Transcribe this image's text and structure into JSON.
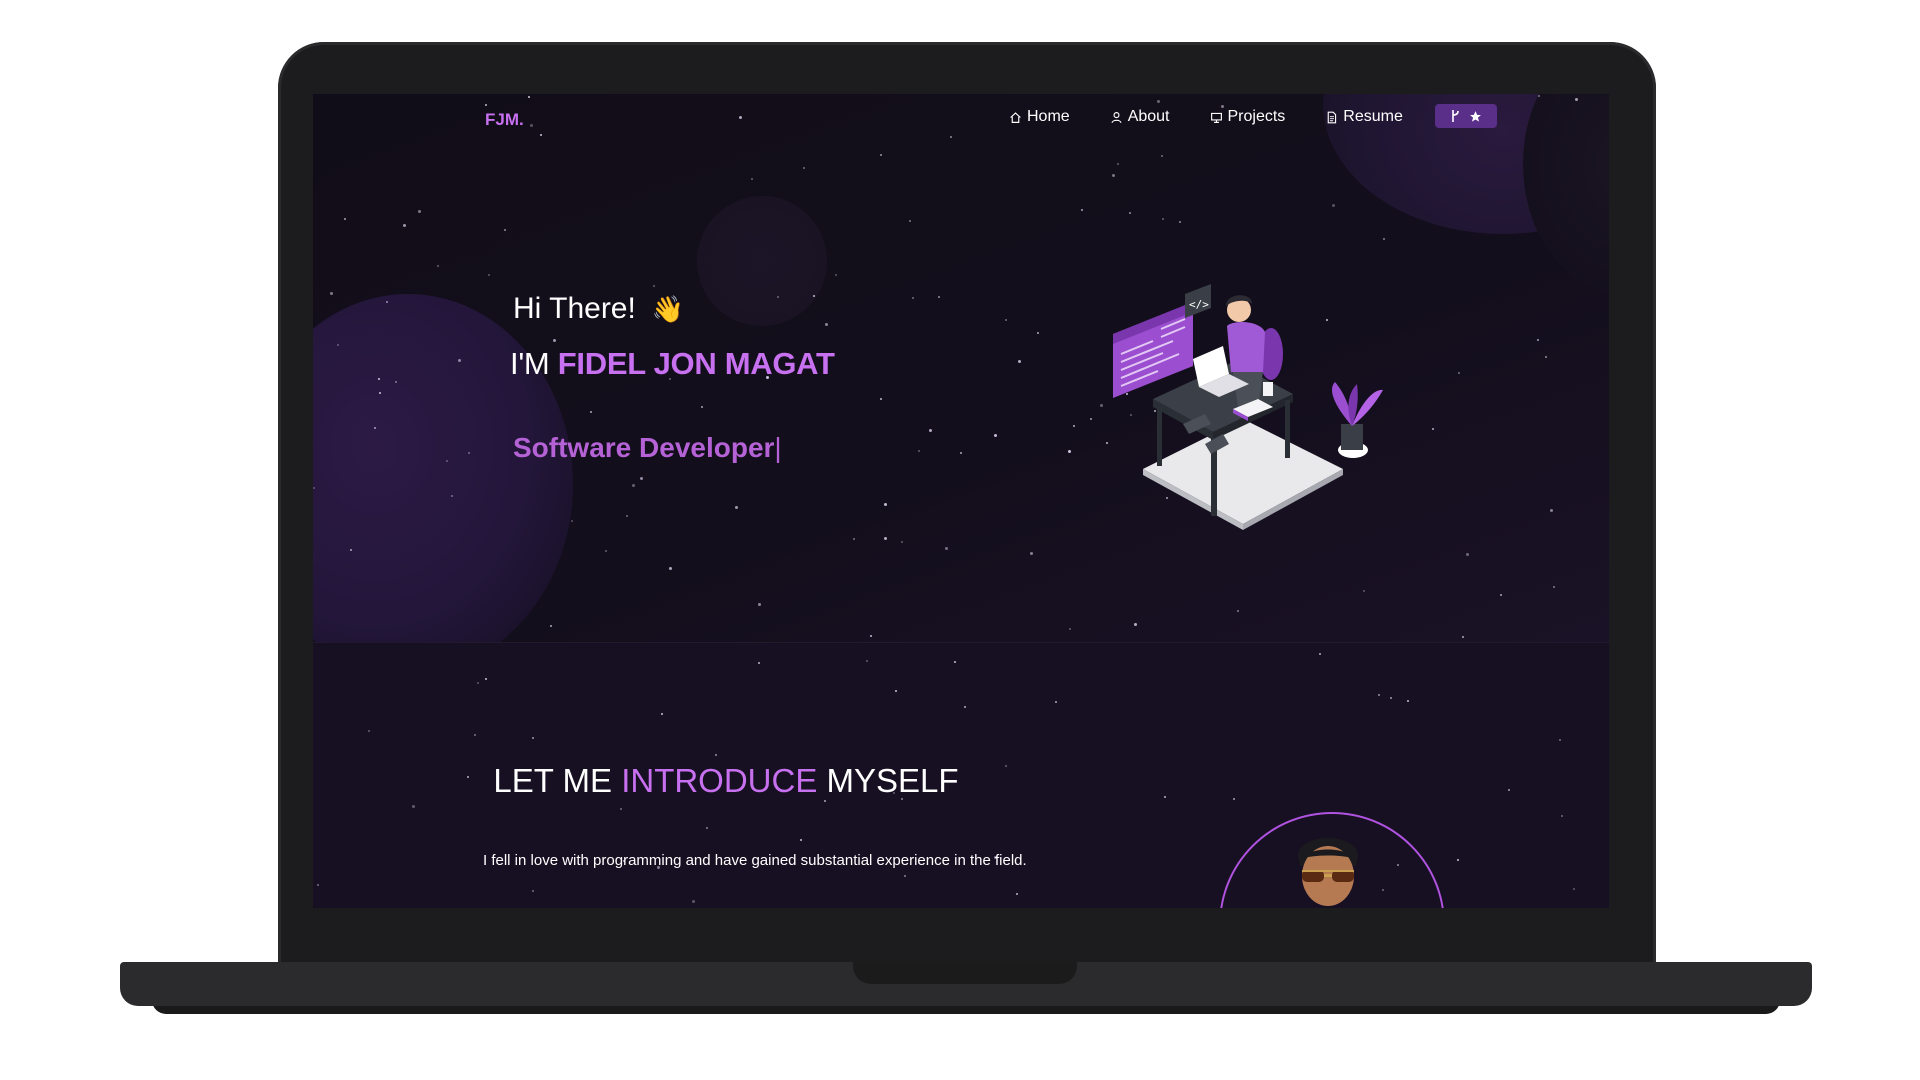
{
  "nav": {
    "logo": "FJM.",
    "links": [
      {
        "label": "Home",
        "icon": "home-icon"
      },
      {
        "label": "About",
        "icon": "user-icon"
      },
      {
        "label": "Projects",
        "icon": "projects-icon"
      },
      {
        "label": "Resume",
        "icon": "document-icon"
      }
    ],
    "cta_icons": [
      "fork-icon",
      "star-icon"
    ]
  },
  "hero": {
    "greeting": "Hi There!",
    "wave_emoji": "👋",
    "name_prefix": "I'M ",
    "name": "FIDEL JON MAGAT",
    "role": "Software Developer",
    "cursor": "|"
  },
  "about": {
    "title_pre": "LET ME ",
    "title_accent": "INTRODUCE",
    "title_post": " MYSELF",
    "text": "I fell in love with programming and have gained substantial experience in the field."
  },
  "colors": {
    "accent": "#c770f0",
    "accent_dark": "#5a2f8a",
    "background": "#0f0b16"
  }
}
